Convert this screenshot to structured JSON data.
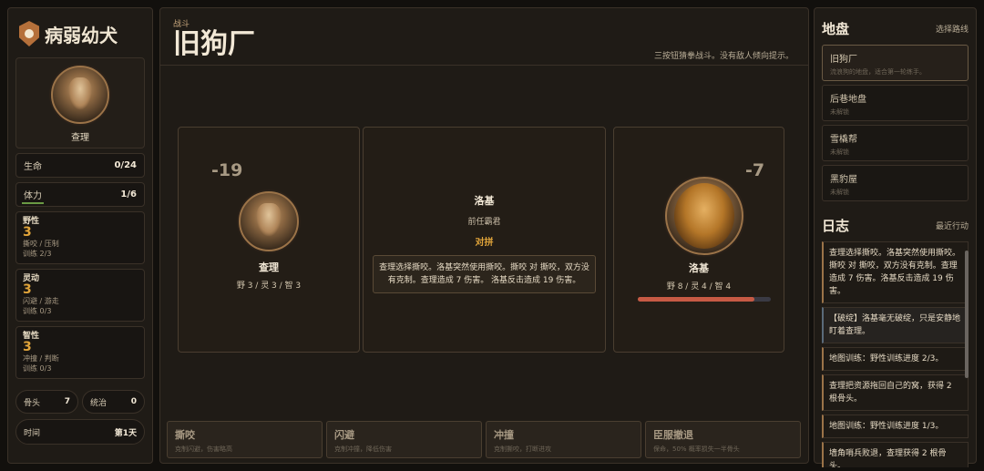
{
  "player": {
    "name": "病弱幼犬",
    "portrait_name": "查理",
    "hp_label": "生命",
    "hp_value": "0/24",
    "stamina_label": "体力",
    "stamina_value": "1/6",
    "attributes": [
      {
        "name": "野性",
        "value": "3",
        "desc": "撕咬 / 压制",
        "train": "训练 2/3"
      },
      {
        "name": "灵动",
        "value": "3",
        "desc": "闪避 / 游走",
        "train": "训练 0/3"
      },
      {
        "name": "智性",
        "value": "3",
        "desc": "冲撞 / 判断",
        "train": "训练 0/3"
      }
    ],
    "bones_label": "骨头",
    "bones_value": "7",
    "rule_label": "统治",
    "rule_value": "0",
    "time_label": "时间",
    "time_value": "第1天"
  },
  "battle": {
    "header_small": "战斗",
    "location": "旧狗厂",
    "hint": "三按钮猜拳战斗。没有敌人倾向提示。",
    "left": {
      "damage": "-19",
      "name": "查理",
      "stats": "野 3 / 灵 3 / 智 3"
    },
    "mid": {
      "enemy_name": "洛基",
      "enemy_title": "前任霸君",
      "mode": "对拼",
      "log": "查理选择撕咬。洛基突然使用撕咬。撕咬 对 撕咬，双方没有克制。查理造成 7 伤害。 洛基反击造成 19 伤害。"
    },
    "right": {
      "damage": "-7",
      "name": "洛基",
      "stats": "野 8 / 灵 4 / 智 4",
      "hp_fraction": 0.88
    },
    "actions": [
      {
        "name": "撕咬",
        "desc": "克制闪避，伤害略高"
      },
      {
        "name": "闪避",
        "desc": "克制冲撞，降低伤害"
      },
      {
        "name": "冲撞",
        "desc": "克制撕咬，打断进攻"
      },
      {
        "name": "臣服撤退",
        "desc": "保命，50% 概率损失一半骨头"
      }
    ]
  },
  "territory": {
    "title": "地盘",
    "link": "选择路线",
    "items": [
      {
        "name": "旧狗厂",
        "desc": "流浪狗的地盘，适合第一轮练手。"
      },
      {
        "name": "后巷地盘",
        "desc": "未解锁"
      },
      {
        "name": "雪橇帮",
        "desc": "未解锁"
      },
      {
        "name": "黑豹屋",
        "desc": "未解锁"
      }
    ]
  },
  "journal": {
    "title": "日志",
    "link": "最近行动",
    "entries": [
      "查理选择撕咬。洛基突然使用撕咬。撕咬 对 撕咬，双方没有克制。查理造成 7 伤害。洛基反击造成 19 伤害。",
      "【破绽】洛基毫无破绽，只是安静地盯着查理。",
      "地图训练：野性训练进度 2/3。",
      "查理把资源拖回自己的窝，获得 2 根骨头。",
      "地图训练：野性训练进度 1/3。",
      "墙角哨兵败退，查理获得 2 根骨头。"
    ]
  }
}
